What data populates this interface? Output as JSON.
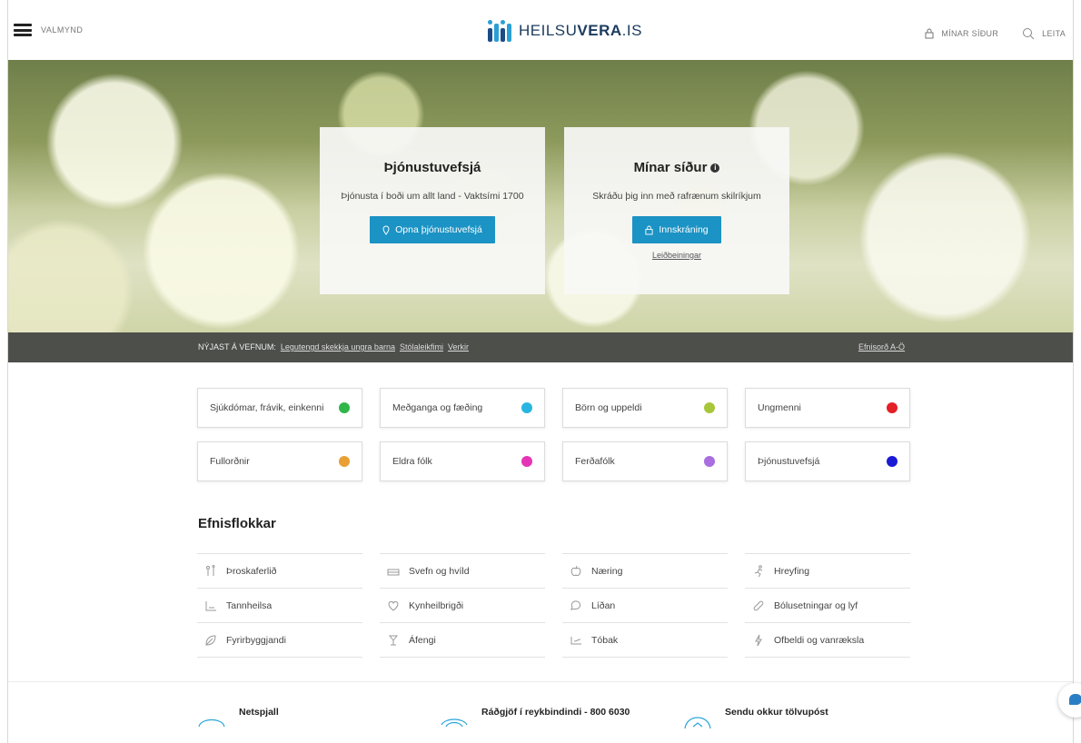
{
  "header": {
    "menu_label": "VALMYND",
    "logo_text_light": "HEILSU",
    "logo_text_bold": "VERA",
    "logo_text_tld": ".IS",
    "my_pages_label": "MÍNAR SÍÐUR",
    "search_label": "LEITA"
  },
  "hero": {
    "left_card": {
      "title": "Þjónustuvefsjá",
      "text": "Þjónusta í boði um allt land - Vaktsími 1700",
      "button": "Opna þjónustuvefsjá"
    },
    "right_card": {
      "title": "Mínar síður",
      "info": "i",
      "text": "Skráðu þig inn með rafrænum skilríkjum",
      "button": "Innskráning",
      "link": "Leiðbeiningar"
    }
  },
  "news": {
    "label": "NÝJAST Á VEFNUM:",
    "links": [
      "Legutengd skekkja ungra barna",
      "Stólaleikfimi",
      "Verkir"
    ],
    "az_link": "Efnisorð A-Ö"
  },
  "categories": [
    {
      "label": "Sjúkdómar, frávik, einkenni",
      "color": "#2fb64a"
    },
    {
      "label": "Meðganga og fæðing",
      "color": "#29b5e0"
    },
    {
      "label": "Börn og uppeldi",
      "color": "#a7c63a"
    },
    {
      "label": "Ungmenni",
      "color": "#e41f26"
    },
    {
      "label": "Fullorðnir",
      "color": "#e8a033"
    },
    {
      "label": "Eldra fólk",
      "color": "#e535b7"
    },
    {
      "label": "Ferðafólk",
      "color": "#a96ee0"
    },
    {
      "label": "Þjónustuvefsjá",
      "color": "#1a1ad6"
    }
  ],
  "topics": {
    "title": "Efnisflokkar",
    "items": [
      {
        "label": "Þroskaferlið",
        "icon": "growth-icon"
      },
      {
        "label": "Svefn og hvíld",
        "icon": "bed-icon"
      },
      {
        "label": "Næring",
        "icon": "apple-icon"
      },
      {
        "label": "Hreyfing",
        "icon": "running-icon"
      },
      {
        "label": "Tannheilsa",
        "icon": "tooth-icon"
      },
      {
        "label": "Kynheilbrigði",
        "icon": "heart-icon"
      },
      {
        "label": "Líðan",
        "icon": "speech-icon"
      },
      {
        "label": "Bólusetningar og lyf",
        "icon": "pill-icon"
      },
      {
        "label": "Fyrirbyggjandi",
        "icon": "leaf-icon"
      },
      {
        "label": "Áfengi",
        "icon": "glass-icon"
      },
      {
        "label": "Tóbak",
        "icon": "cigarette-icon"
      },
      {
        "label": "Ofbeldi og vanræksla",
        "icon": "lightning-icon"
      }
    ]
  },
  "contacts": [
    {
      "label": "Netspjall"
    },
    {
      "label": "Ráðgjöf í reykbindindi - 800 6030"
    },
    {
      "label": "Sendu okkur tölvupóst"
    }
  ]
}
